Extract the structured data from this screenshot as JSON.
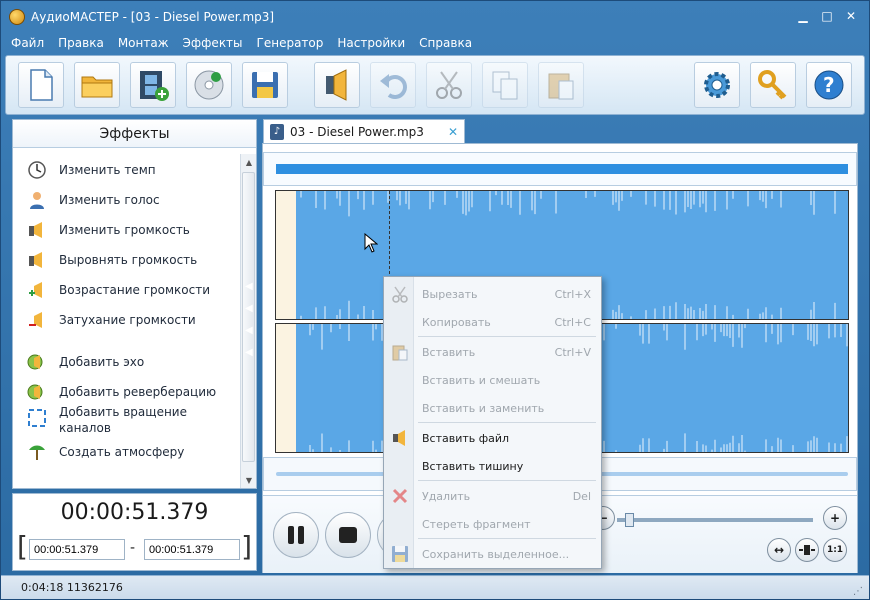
{
  "window": {
    "title": "АудиоМАСТЕР - [03 - Diesel Power.mp3]",
    "controls": [
      "minimize-icon",
      "maximize-icon",
      "close-icon"
    ]
  },
  "menu": [
    "Файл",
    "Правка",
    "Монтаж",
    "Эффекты",
    "Генератор",
    "Настройки",
    "Справка"
  ],
  "toolbar": {
    "buttons": [
      {
        "name": "new-file",
        "icon": "new-file-icon",
        "enabled": true
      },
      {
        "name": "open-folder",
        "icon": "folder-icon",
        "enabled": true
      },
      {
        "name": "add-video",
        "icon": "film-add-icon",
        "enabled": true
      },
      {
        "name": "cd-rip",
        "icon": "cd-icon",
        "enabled": true
      },
      {
        "name": "save",
        "icon": "floppy-icon",
        "enabled": true
      },
      {
        "name": "speaker",
        "icon": "speaker-icon",
        "enabled": true
      },
      {
        "name": "undo",
        "icon": "undo-icon",
        "enabled": false
      },
      {
        "name": "cut",
        "icon": "scissors-icon",
        "enabled": false
      },
      {
        "name": "copy",
        "icon": "copy-icon",
        "enabled": false
      },
      {
        "name": "paste",
        "icon": "paste-icon",
        "enabled": false
      },
      {
        "name": "settings",
        "icon": "gear-icon",
        "enabled": true
      },
      {
        "name": "keys",
        "icon": "key-icon",
        "enabled": true
      },
      {
        "name": "help",
        "icon": "help-icon",
        "enabled": true
      }
    ]
  },
  "effects_panel": {
    "title": "Эффекты",
    "items": [
      {
        "label": "Изменить темп",
        "icon": "clock-icon"
      },
      {
        "label": "Изменить голос",
        "icon": "user-voice-icon"
      },
      {
        "label": "Изменить громкость",
        "icon": "volume-icon"
      },
      {
        "label": "Выровнять громкость",
        "icon": "equalize-volume-icon"
      },
      {
        "label": "Возрастание громкости",
        "icon": "fade-in-icon"
      },
      {
        "label": "Затухание громкости",
        "icon": "fade-out-icon"
      },
      {
        "label": "Добавить эхо",
        "icon": "echo-icon"
      },
      {
        "label": "Добавить реверберацию",
        "icon": "reverb-icon"
      },
      {
        "label": "Добавить вращение каналов",
        "icon": "rotate-channels-icon"
      },
      {
        "label": "Создать атмосферу",
        "icon": "atmosphere-icon"
      }
    ]
  },
  "time": {
    "current": "00:00:51.379",
    "sel_start": "00:00:51.379",
    "sel_end": "00:00:51.379",
    "dash": "-",
    "left_bracket": "[",
    "right_bracket": "]"
  },
  "tab": {
    "label": "03 - Diesel Power.mp3",
    "close": "✕"
  },
  "context_menu": {
    "items": [
      {
        "label": "Вырезать",
        "shortcut": "Ctrl+X",
        "icon": "scissors-icon",
        "enabled": false
      },
      {
        "label": "Копировать",
        "shortcut": "Ctrl+C",
        "icon": "",
        "enabled": false
      },
      {
        "label": "Вставить",
        "shortcut": "Ctrl+V",
        "icon": "paste-icon",
        "enabled": false
      },
      {
        "label": "Вставить и смешать",
        "shortcut": "",
        "icon": "",
        "enabled": false
      },
      {
        "label": "Вставить и заменить",
        "shortcut": "",
        "icon": "",
        "enabled": false
      },
      {
        "label": "Вставить файл",
        "shortcut": "",
        "icon": "insert-file-icon",
        "enabled": true
      },
      {
        "label": "Вставить тишину",
        "shortcut": "",
        "icon": "",
        "enabled": true
      },
      {
        "label": "Удалить",
        "shortcut": "Del",
        "icon": "delete-icon",
        "enabled": false
      },
      {
        "label": "Стереть фрагмент",
        "shortcut": "",
        "icon": "",
        "enabled": false
      },
      {
        "label": "Сохранить выделенное...",
        "shortcut": "",
        "icon": "save-selection-icon",
        "enabled": false
      }
    ]
  },
  "transport": {
    "zoom_in": "+",
    "zoom_out": "−",
    "fit": "↔",
    "one_to_one": "1:1"
  },
  "status": {
    "text": "0:04:18 11362176"
  }
}
